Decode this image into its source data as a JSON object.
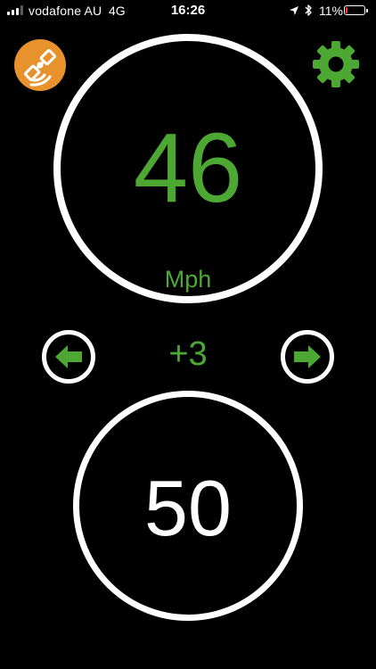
{
  "status_bar": {
    "carrier": "vodafone AU",
    "network": "4G",
    "time": "16:26",
    "battery_percent": "11%",
    "battery_level": 0.11,
    "signal_bars": 3,
    "signal_bars_total": 4
  },
  "speed": {
    "value": "46",
    "unit": "Mph"
  },
  "offset": {
    "value": "+3"
  },
  "limit": {
    "value": "50"
  },
  "icons": {
    "app_logo": "satellite-icon",
    "settings": "gear-icon",
    "decrease": "arrow-left-icon",
    "increase": "arrow-right-icon",
    "location": "location-arrow-icon",
    "bluetooth": "bluetooth-icon"
  },
  "colors": {
    "background": "#000000",
    "accent_green": "#4da833",
    "logo_orange": "#e8922e",
    "ring_white": "#ffffff",
    "battery_low": "#ff3b30"
  }
}
